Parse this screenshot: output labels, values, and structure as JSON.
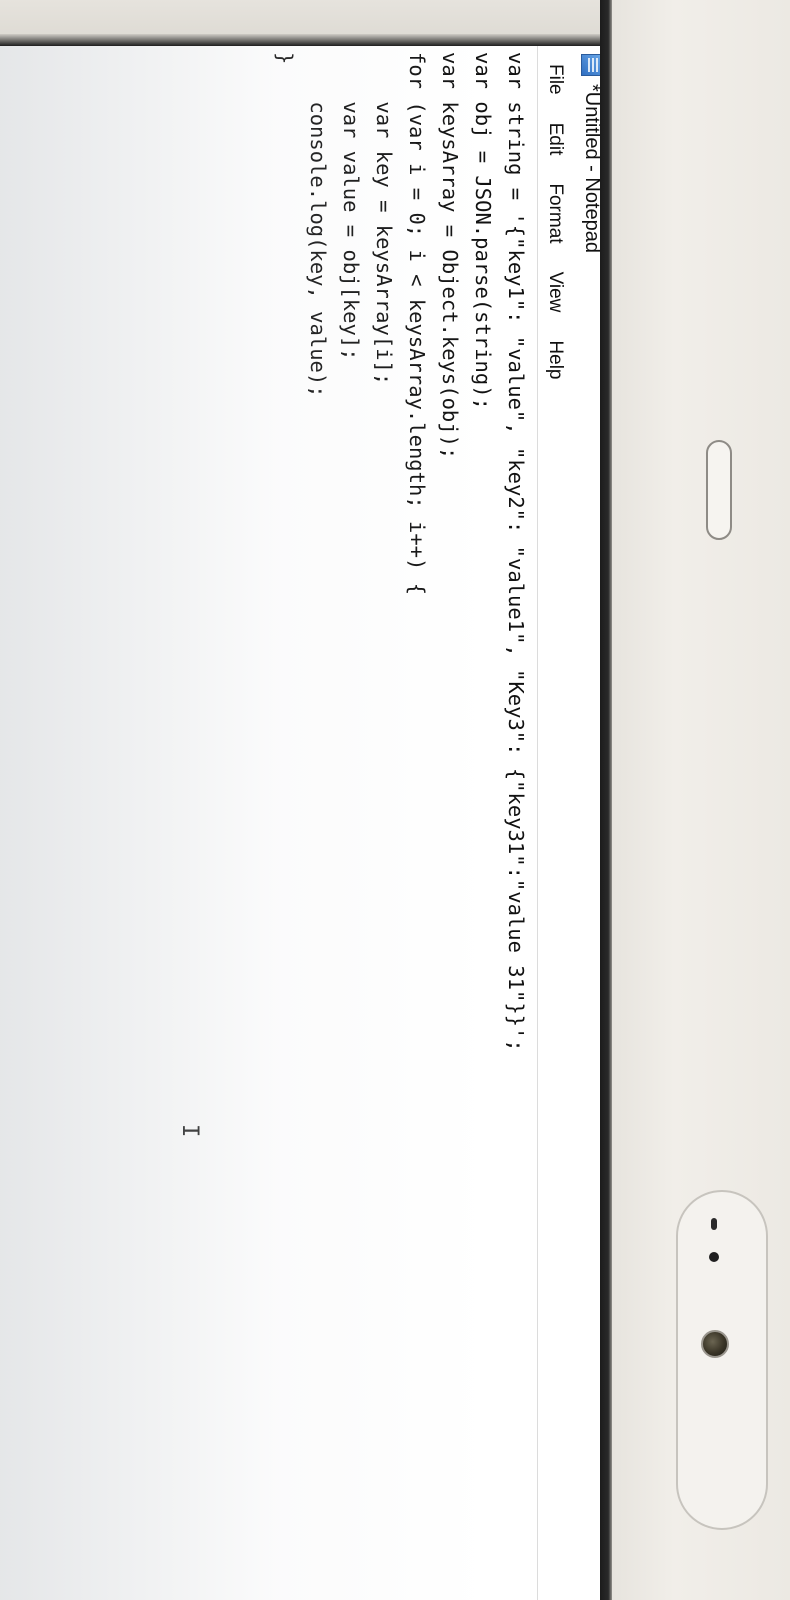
{
  "window": {
    "title": "*Untitled - Notepad",
    "icon": "notepad-icon"
  },
  "menu": {
    "items": [
      {
        "label": "File"
      },
      {
        "label": "Edit"
      },
      {
        "label": "Format"
      },
      {
        "label": "View"
      },
      {
        "label": "Help"
      }
    ]
  },
  "editor": {
    "lines": [
      "var string = '{\"key1\": \"value\", \"key2\": \"value1\", \"Key3\": {\"key31\":\"value 31\"}}';",
      "var obj = JSON.parse(string);",
      "var keysArray = Object.keys(obj);",
      "for (var i = 0; i < keysArray.length; i++) {",
      "    var key = keysArray[i];",
      "    var value = obj[key];",
      "    console.log(key, value);",
      "}"
    ],
    "cursor_glyph": "I"
  },
  "colors": {
    "window_background": "#ffffff",
    "text": "#111111",
    "bezel": "#ece9e3",
    "screen_border": "#1b1b1b"
  }
}
